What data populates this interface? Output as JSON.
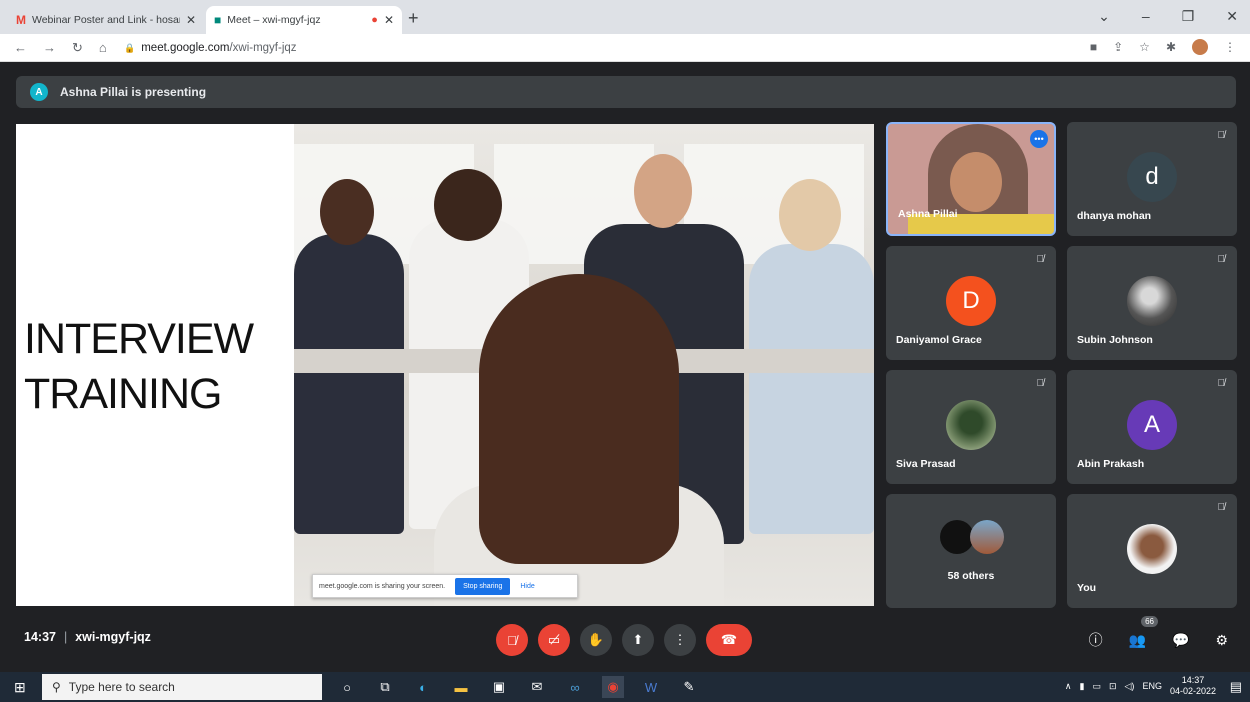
{
  "browser": {
    "tabs": [
      {
        "title": "Webinar Poster and Link - hosan",
        "icon": "gmail-icon"
      },
      {
        "title": "Meet – xwi-mgyf-jqz",
        "icon": "meet-icon",
        "recording": true
      }
    ],
    "url": {
      "domain": "meet.google.com",
      "path": "/xwi-mgyf-jqz"
    }
  },
  "meet": {
    "presenting_banner": "Ashna Pillai is presenting",
    "presenter_initial": "A",
    "slide": {
      "line1": "INTERVIEW",
      "line2": "TRAINING"
    },
    "share_bar": {
      "text": "meet.google.com is sharing your screen.",
      "stop": "Stop sharing",
      "hide": "Hide"
    },
    "participants": [
      {
        "name": "Ashna Pillai",
        "type": "video",
        "active": true
      },
      {
        "name": "dhanya mohan",
        "initial": "d",
        "color": "#37474f"
      },
      {
        "name": "Daniyamol Grace",
        "initial": "D",
        "color": "#f4511e"
      },
      {
        "name": "Subin Johnson",
        "type": "photo"
      },
      {
        "name": "Siva Prasad",
        "type": "photo"
      },
      {
        "name": "Abin Prakash",
        "initial": "A",
        "color": "#673ab7"
      },
      {
        "name": "58 others",
        "type": "others"
      },
      {
        "name": "You",
        "type": "photo"
      }
    ],
    "time": "14:37",
    "code": "xwi-mgyf-jqz",
    "people_count": "66"
  },
  "taskbar": {
    "search_placeholder": "Type here to search",
    "lang": "ENG",
    "time": "14:37",
    "date": "04-02-2022"
  }
}
